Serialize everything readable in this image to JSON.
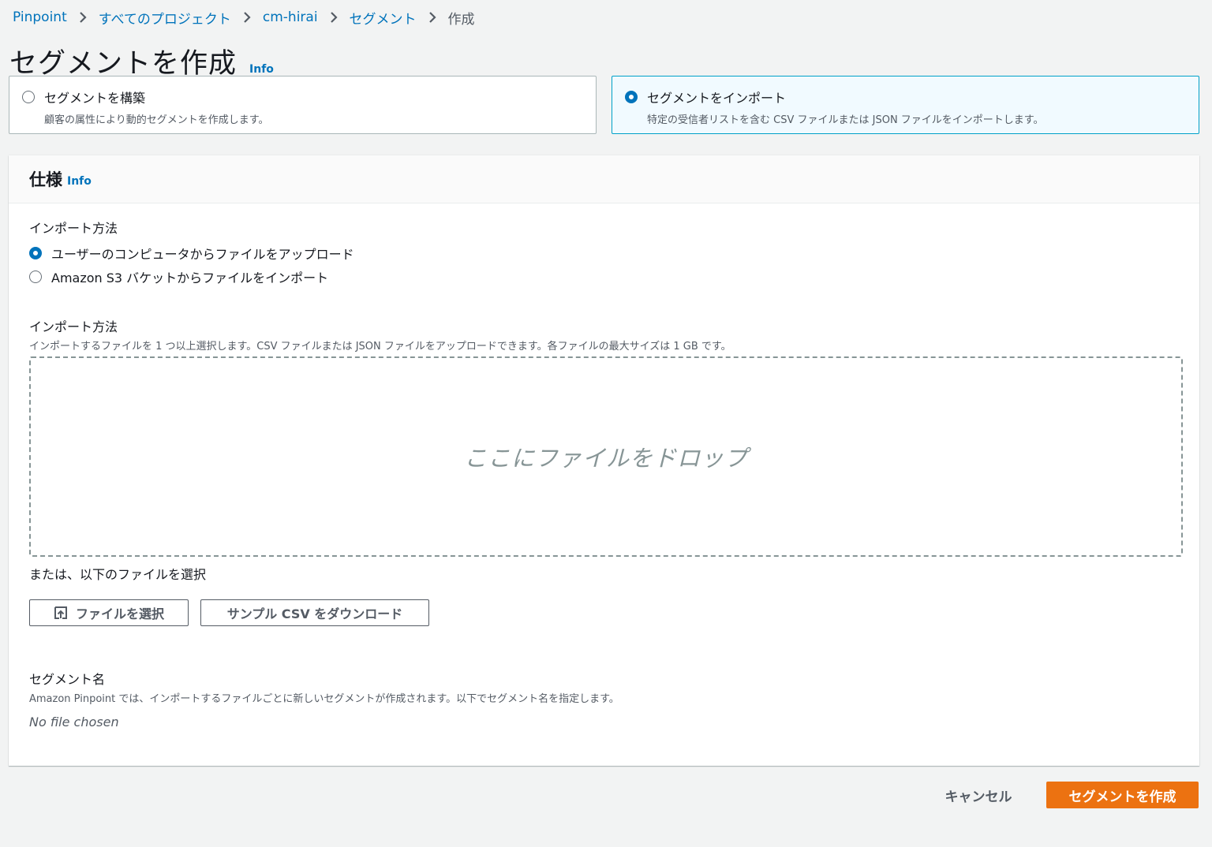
{
  "breadcrumb": {
    "items": [
      "Pinpoint",
      "すべてのプロジェクト",
      "cm-hirai",
      "セグメント"
    ],
    "current": "作成"
  },
  "header": {
    "title": "セグメントを作成",
    "info": "Info"
  },
  "tiles": {
    "build": {
      "label": "セグメントを構築",
      "description": "顧客の属性により動的セグメントを作成します。",
      "selected": false
    },
    "import": {
      "label": "セグメントをインポート",
      "description": "特定の受信者リストを含む CSV ファイルまたは JSON ファイルをインポートします。",
      "selected": true
    }
  },
  "spec": {
    "title": "仕様",
    "info": "Info",
    "import_method_label": "インポート方法",
    "options": [
      {
        "label": "ユーザーのコンピュータからファイルをアップロード",
        "selected": true
      },
      {
        "label": "Amazon S3 バケットからファイルをインポート",
        "selected": false
      }
    ],
    "file_section_label": "インポート方法",
    "file_section_desc": "インポートするファイルを 1 つ以上選択します。CSV ファイルまたは JSON ファイルをアップロードできます。各ファイルの最大サイズは 1 GB です。",
    "dropzone_text": "ここにファイルをドロップ",
    "or_select_text": "または、以下のファイルを選択",
    "choose_file_button": "ファイルを選択",
    "sample_csv_button": "サンプル CSV をダウンロード",
    "segment_name_label": "セグメント名",
    "segment_name_desc": "Amazon Pinpoint では、インポートするファイルごとに新しいセグメントが作成されます。以下でセグメント名を指定します。",
    "no_file_text": "No file chosen"
  },
  "footer": {
    "cancel": "キャンセル",
    "create": "セグメントを作成"
  },
  "colors": {
    "link": "#0073bb",
    "primary": "#ec7211",
    "selected_border": "#00a1c9"
  }
}
